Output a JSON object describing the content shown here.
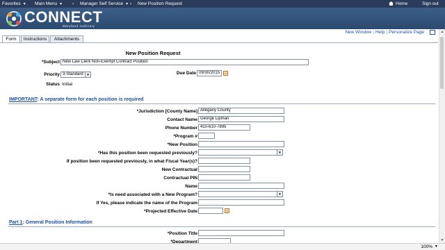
{
  "topnav": {
    "favorites": "Favorites",
    "main_menu": "Main Menu",
    "breadcrumb_1": "Manager Self Service",
    "breadcrumb_2": "New Position Request",
    "home": "Home",
    "signout": "Sign out"
  },
  "header": {
    "logo": "CONNECT",
    "logo_sub": "Maryland Judiciary"
  },
  "util_links": {
    "new_window": "New Window",
    "help": "Help",
    "personalize": "Personalize Page"
  },
  "tabs": [
    "Form",
    "Instructions",
    "Attachments"
  ],
  "form": {
    "title": "New Position Request",
    "subject_label": "*Subject",
    "subject_value": "New Law Clerk Non-Exempt Contract Position",
    "priority_label": "Priority",
    "priority_value": "3-Standard",
    "due_label": "Due Date",
    "due_value": "09/30/2015",
    "status_label": "Status",
    "status_value": "Initial"
  },
  "section_important": {
    "lead": "IMPORTANT",
    "rest": ": A separate form for each position is required"
  },
  "fields": {
    "jurisdiction_label": "*Jurisdiction [County Name]",
    "jurisdiction_value": "Allegany County",
    "contact_label": "Contact Name",
    "contact_value": "George Lipman",
    "phone_label": "Phone Number",
    "phone_value": "410-610-7895",
    "program_label": "*Program #",
    "newpos_label": "*New Position",
    "requested_label": "*Has this position been requested previously?",
    "fiscal_label": "If position been requested previously, in what Fiscal Year(s)?",
    "newcontract_label": "New Contractual",
    "contractpin_label": "Contractual PIN",
    "name_label": "Name",
    "newprogram_label": "*Is need associated with a New Program?",
    "programname_label": "If Yes, please indicate the name of the Program",
    "effective_label": "*Projected Effective Date"
  },
  "section_part1": {
    "lead": "Part 1",
    "rest": ": General Position Information"
  },
  "part1": {
    "title_label": "*Position Title",
    "dept_label": "*Department"
  },
  "status": {
    "zoom": "100%"
  }
}
